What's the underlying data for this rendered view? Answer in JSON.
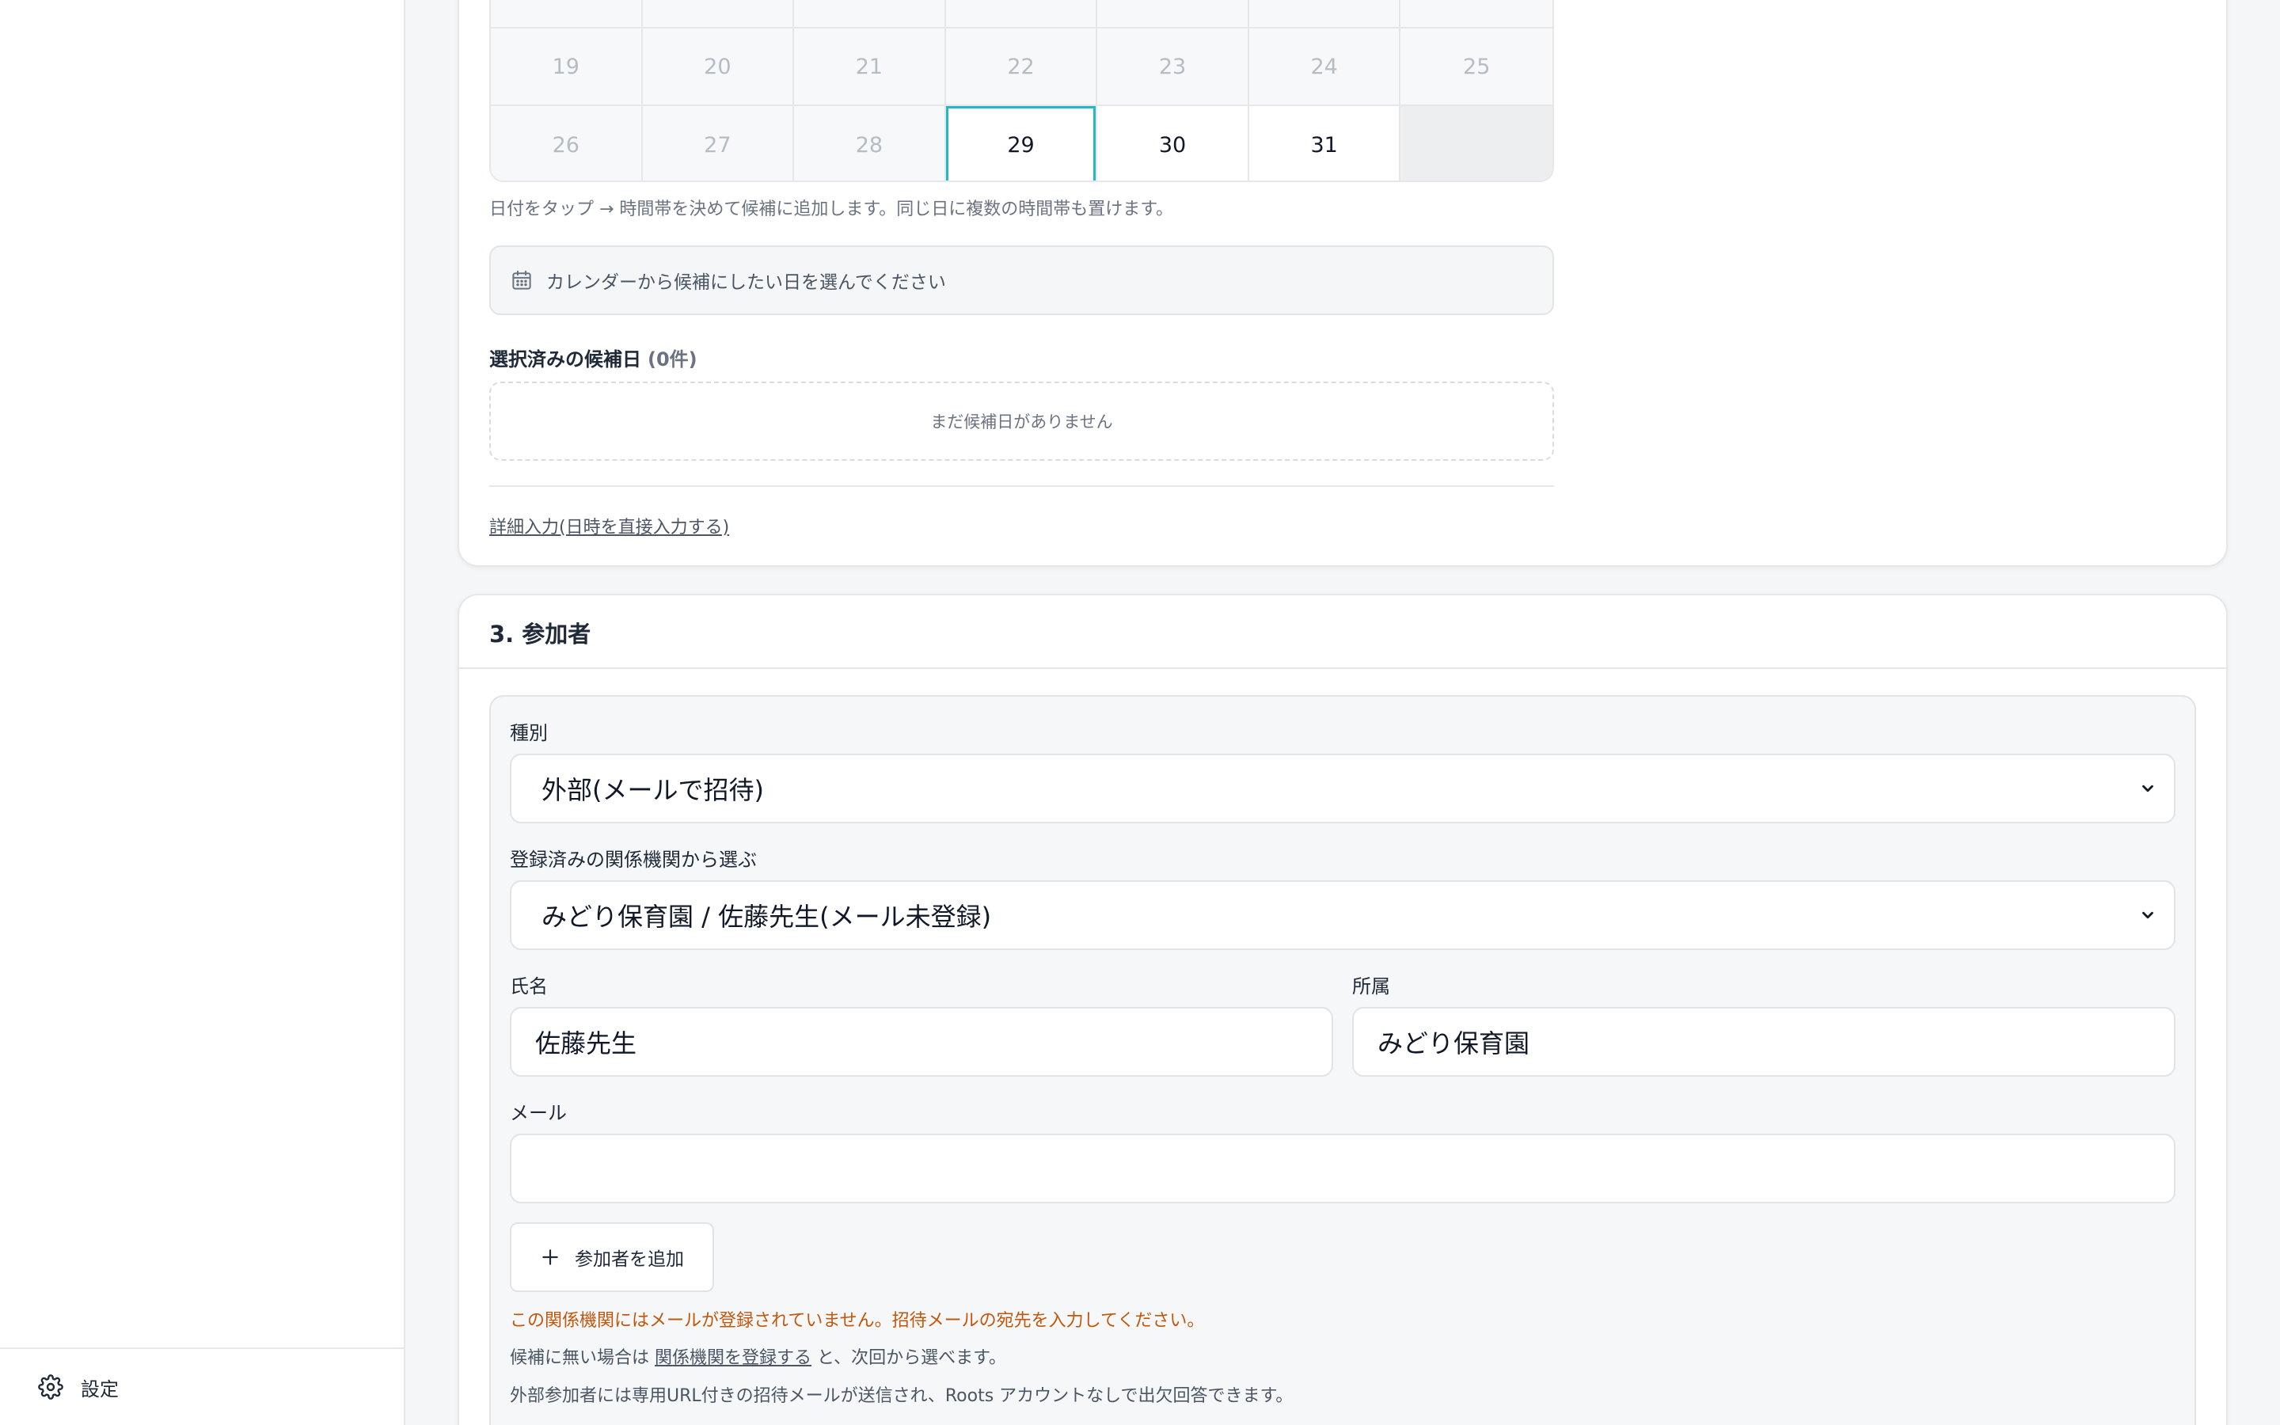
{
  "sidebar": {
    "settings_label": "設定"
  },
  "calendar": {
    "rows": [
      [
        "",
        "",
        "",
        "",
        "",
        "",
        ""
      ],
      [
        "19",
        "20",
        "21",
        "22",
        "23",
        "24",
        "25"
      ],
      [
        "26",
        "27",
        "28",
        "29",
        "30",
        "31",
        ""
      ]
    ],
    "selected_day": "29",
    "selected_color": "#22b8c8"
  },
  "schedule": {
    "hint": "日付をタップ → 時間帯を決めて候補に追加します。同じ日に複数の時間帯も置けます。",
    "picker_placeholder": "カレンダーから候補にしたい日を選んでください",
    "selected_title": "選択済みの候補日",
    "selected_count": "(0件)",
    "empty_text": "まだ候補日がありません",
    "detail_link": "詳細入力(日時を直接入力する)"
  },
  "participants": {
    "section_title": "3. 参加者",
    "type_label": "種別",
    "type_value": "外部(メールで招待)",
    "org_label": "登録済みの関係機関から選ぶ",
    "org_value": "みどり保育園 / 佐藤先生(メール未登録)",
    "name_label": "氏名",
    "name_value": "佐藤先生",
    "affiliation_label": "所属",
    "affiliation_value": "みどり保育園",
    "email_label": "メール",
    "email_value": "",
    "add_button": "参加者を追加",
    "warning": "この関係機関にはメールが登録されていません。招待メールの宛先を入力してください。",
    "note1_prefix": "候補に無い場合は",
    "note1_link": "関係機関を登録する",
    "note1_suffix": "と、次回から選べます。",
    "note2": "外部参加者には専用URL付きの招待メールが送信され、Roots アカウントなしで出欠回答できます。",
    "warning_color": "#c2570c"
  }
}
